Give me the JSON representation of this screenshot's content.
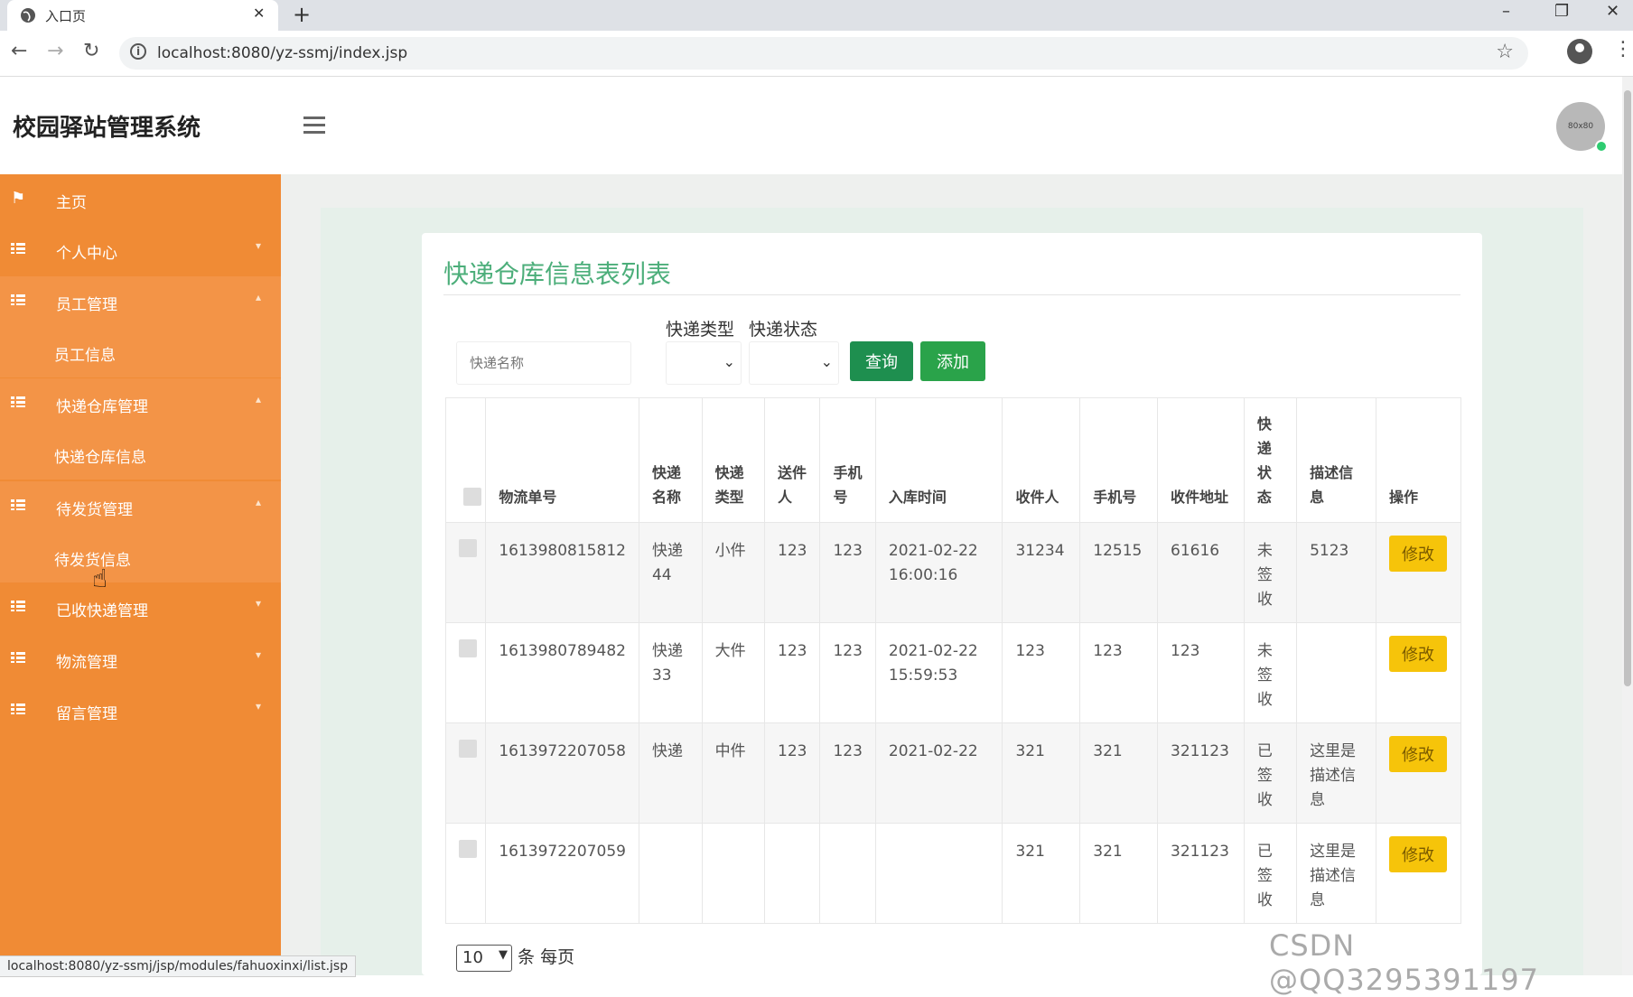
{
  "browser": {
    "tab_title": "入口页",
    "url": "localhost:8080/yz-ssmj/index.jsp",
    "status_url": "localhost:8080/yz-ssmj/jsp/modules/fahuoxinxi/list.jsp"
  },
  "header": {
    "brand": "校园驿站管理系统",
    "avatar_text": "80x80"
  },
  "sidebar": {
    "items": [
      {
        "label": "主页"
      },
      {
        "label": "个人中心"
      },
      {
        "label": "员工管理"
      },
      {
        "label": "员工信息"
      },
      {
        "label": "快递仓库管理"
      },
      {
        "label": "快递仓库信息"
      },
      {
        "label": "待发货管理"
      },
      {
        "label": "待发货信息"
      },
      {
        "label": "已收快递管理"
      },
      {
        "label": "物流管理"
      },
      {
        "label": "留言管理"
      }
    ]
  },
  "main": {
    "title": "快递仓库信息表列表",
    "filters": {
      "type_label": "快递类型",
      "status_label": "快递状态",
      "name_placeholder": "快递名称"
    },
    "buttons": {
      "query": "查询",
      "add": "添加",
      "edit": "修改"
    },
    "table": {
      "headers": [
        "物流单号",
        "快递名称",
        "快递类型",
        "送件人",
        "手机号",
        "入库时间",
        "收件人",
        "手机号",
        "收件地址",
        "快递状态",
        "描述信息",
        "操作"
      ],
      "rows": [
        [
          "1613980815812",
          "快递44",
          "小件",
          "123",
          "123",
          "2021-02-22 16:00:16",
          "31234",
          "12515",
          "61616",
          "未签收",
          "5123"
        ],
        [
          "1613980789482",
          "快递33",
          "大件",
          "123",
          "123",
          "2021-02-22 15:59:53",
          "123",
          "123",
          "123",
          "未签收",
          ""
        ],
        [
          "1613972207058",
          "快递",
          "中件",
          "123",
          "123",
          "2021-02-22",
          "321",
          "321",
          "321123",
          "已签收",
          "这里是描述信息"
        ],
        [
          "1613972207059",
          "",
          "",
          "",
          "",
          "",
          "321",
          "321",
          "321123",
          "已签收",
          "这里是描述信息"
        ]
      ]
    },
    "pager": {
      "page_size": "10",
      "suffix": "条 每页"
    }
  },
  "watermark": "CSDN @QQ3295391197"
}
